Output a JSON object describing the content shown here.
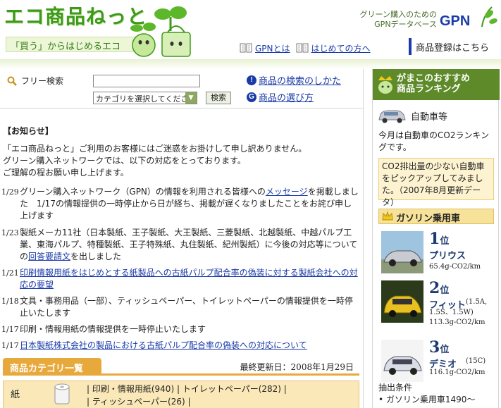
{
  "header": {
    "logo": "エコ商品ねっと",
    "tagline": "「買う」からはじめるエコ",
    "gpn_text_line1": "グリーン購入のための",
    "gpn_text_line2": "GPNデータベース",
    "gpn_logo": "GPN",
    "nav": [
      {
        "label": "GPNとは"
      },
      {
        "label": "はじめての方へ"
      }
    ],
    "register": "商品登録はこちら"
  },
  "search": {
    "label": "フリー検索",
    "category_placeholder": "カテゴリを選択してくださ",
    "button": "検索",
    "help_how": "商品の検索のしかた",
    "help_choose": "商品の選び方"
  },
  "notice": {
    "heading": "【お知らせ】",
    "intro": [
      "「エコ商品ねっと」ご利用のお客様にはご迷惑をお掛けして申し訳ありません。",
      "グリーン購入ネットワークでは、以下の対応をとっております。",
      "ご理解の程お願い申し上げます。"
    ],
    "items": [
      {
        "date": "1/29",
        "pre": "グリーン購入ネットワーク（GPN）の情報を利用される皆様への",
        "link": "メッセージ",
        "post": "を掲載しました　1/17の情報提供の一時停止から日が経ち、掲載が遅くなりましたことをお詫び申し上げます"
      },
      {
        "date": "1/23",
        "pre": "製紙メーカ11社（日本製紙、王子製紙、大王製紙、三菱製紙、北越製紙、中越パルプ工業、東海パルプ、特種製紙、王子特殊紙、丸住製紙、紀州製紙）に今後の対応等についての",
        "link": "回答要請文",
        "post": "を出しました"
      },
      {
        "date": "1/21",
        "pre": "",
        "link": "印刷情報用紙をはじめとする紙製品への古紙パルプ配合率の偽装に対する製紙会社への対応の要望",
        "post": ""
      },
      {
        "date": "1/18",
        "pre": "文具・事務用品（一部）、ティッシュペーパー、トイレットペーパーの情報提供を一時停止いたします",
        "link": "",
        "post": ""
      },
      {
        "date": "1/17",
        "pre": "印刷・情報用紙の情報提供を一時停止いたします",
        "link": "",
        "post": ""
      },
      {
        "date": "1/17",
        "pre": "",
        "link": "日本製紙株式会社の製品における古紙パルプ配合率の偽装への対応について",
        "post": ""
      }
    ]
  },
  "categories": {
    "tab": "商品カテゴリ一覧",
    "updated_label": "最終更新日：",
    "updated_date": "2008年1月29日",
    "paper": {
      "name": "紙",
      "links": [
        "印刷・情報用紙(940)",
        "トイレットペーパー(282)",
        "ティッシュペーパー(26)"
      ]
    }
  },
  "sidebar": {
    "title_line1": "がまこのおすすめ",
    "title_line2": "商品ランキング",
    "category": "自動車等",
    "desc": "今月は自動車のCO2ランキングです。",
    "note": "CO2排出量の少ない自動車をピックアップしてみました。（2007年8月更新データ）",
    "gasoline": "ガソリン乗用車",
    "rank_suffix": "位",
    "ranks": [
      {
        "rank": "1",
        "name": "プリウス",
        "detail1": "65.4g-CO2/km",
        "detail2": "",
        "detail3": "",
        "color": "#c8ccd2"
      },
      {
        "rank": "2",
        "name": "フィット",
        "detail1": "(1.5A,",
        "detail2": "1.5S、1.5W)",
        "detail3": "113.3g-CO2/km",
        "color": "#e8c020"
      },
      {
        "rank": "3",
        "name": "デミオ",
        "detail1": "(15C)",
        "detail2": "116.1g-CO2/km",
        "detail3": "",
        "color": "#d8dde6"
      }
    ],
    "criteria_label": "抽出条件",
    "criteria_item": "ガソリン乗用車1490〜"
  }
}
